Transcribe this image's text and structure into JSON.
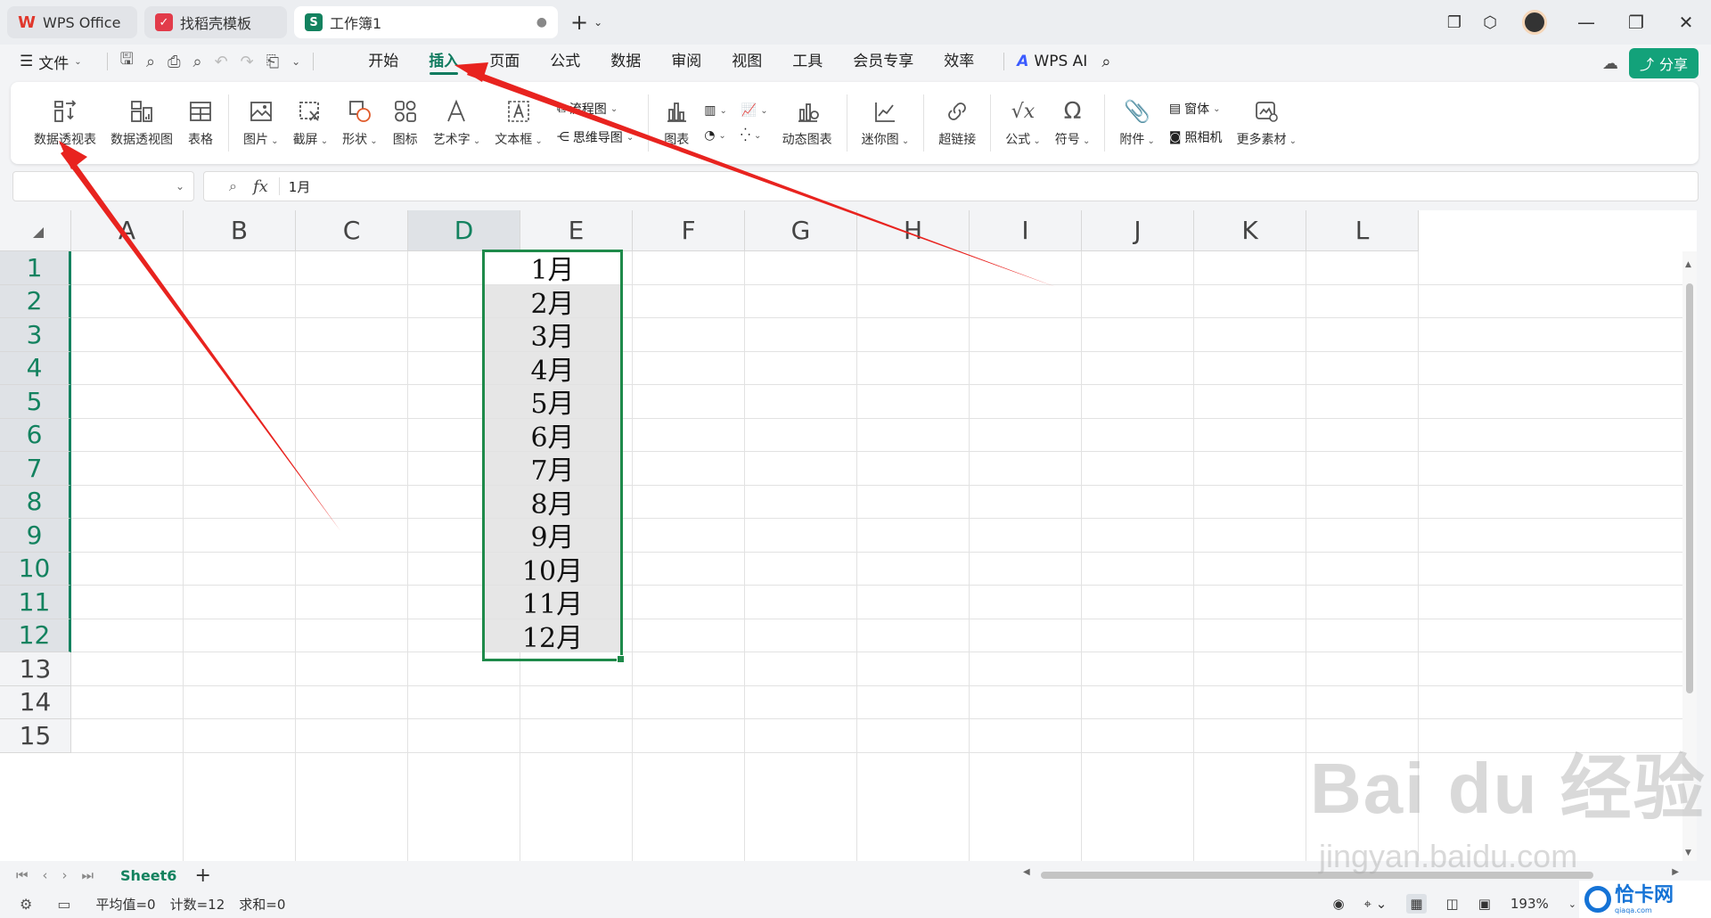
{
  "colors": {
    "accent": "#0f7b5f",
    "selection_border": "#1e8a4a",
    "share_button": "#13a27a",
    "annotation_arrow": "#e8231f"
  },
  "tabs": [
    {
      "label": "WPS Office",
      "icon": "wps-logo-icon",
      "color": "#e0372c"
    },
    {
      "label": "找稻壳模板",
      "icon": "docer-icon",
      "color": "#e23b4a"
    },
    {
      "label": "工作簿1",
      "icon": "spreadsheet-s-icon",
      "color": "#13825f",
      "active": true
    }
  ],
  "menubar": {
    "file_label": "文件",
    "items": [
      "开始",
      "插入",
      "页面",
      "公式",
      "数据",
      "审阅",
      "视图",
      "工具",
      "会员专享",
      "效率"
    ],
    "active_item": "插入",
    "wps_ai_label": "WPS AI",
    "share_label": "分享"
  },
  "ribbon": {
    "pivot_table": "数据透视表",
    "pivot_chart": "数据透视图",
    "table": "表格",
    "picture": "图片",
    "screenshot": "截屏",
    "shape": "形状",
    "icon": "图标",
    "word_art": "艺术字",
    "text_box": "文本框",
    "flowchart": "流程图",
    "mind_map": "思维导图",
    "chart": "图表",
    "dynamic_chart": "动态图表",
    "sparkline": "迷你图",
    "hyperlink": "超链接",
    "formula": "公式",
    "symbol": "符号",
    "attachment": "附件",
    "form": "窗体",
    "camera": "照相机",
    "more_materials": "更多素材"
  },
  "formula_bar": {
    "fx_label": "fx",
    "value": "1月"
  },
  "grid": {
    "columns": [
      "A",
      "B",
      "C",
      "D",
      "E",
      "F",
      "G",
      "H",
      "I",
      "J",
      "K",
      "L"
    ],
    "selected_column": "D",
    "rows": [
      "1",
      "2",
      "3",
      "4",
      "5",
      "6",
      "7",
      "8",
      "9",
      "10",
      "11",
      "12",
      "13",
      "14",
      "15"
    ],
    "d_values": [
      "1月",
      "2月",
      "3月",
      "4月",
      "5月",
      "6月",
      "7月",
      "8月",
      "9月",
      "10月",
      "11月",
      "12月"
    ]
  },
  "sheets": {
    "tabs": [
      "Sheet6"
    ]
  },
  "status": {
    "average": "平均值=0",
    "count": "计数=12",
    "sum": "求和=0",
    "zoom": "193%"
  },
  "watermarks": {
    "baidu": "Bai du 经验",
    "url": "jingyan.baidu.com",
    "site": "恰卡网",
    "site_sub": "qiaqa.com"
  }
}
